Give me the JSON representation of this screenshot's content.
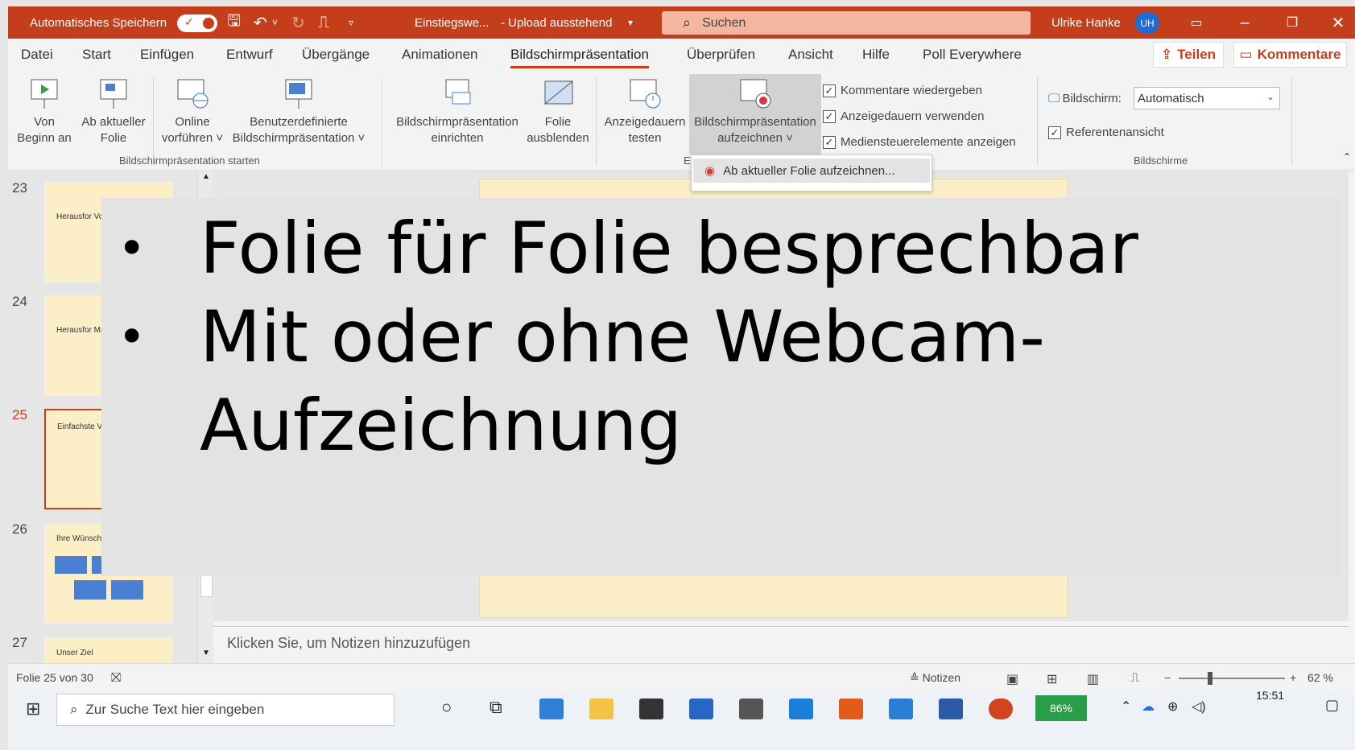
{
  "titlebar": {
    "autosave_label": "Automatisches Speichern",
    "doc_name": "Einstiegswe...",
    "doc_status": "- Upload ausstehend",
    "search_placeholder": "Suchen",
    "user_name": "Ulrike Hanke",
    "user_initials": "UH"
  },
  "tabs": [
    "Datei",
    "Start",
    "Einfügen",
    "Entwurf",
    "Übergänge",
    "Animationen",
    "Bildschirmpräsentation",
    "Überprüfen",
    "Ansicht",
    "Hilfe",
    "Poll Everywhere"
  ],
  "actions": {
    "share": "Teilen",
    "comment": "Kommentare"
  },
  "ribbon": {
    "from_start": [
      "Von",
      "Beginn an"
    ],
    "from_current": [
      "Ab aktueller",
      "Folie"
    ],
    "online": [
      "Online",
      "vorführen ˅"
    ],
    "custom": [
      "Benutzerdefinierte",
      "Bildschirmpräsentation ˅"
    ],
    "group_start": "Bildschirmpräsentation starten",
    "setup": [
      "Bildschirmpräsentation",
      "einrichten"
    ],
    "hide": [
      "Folie",
      "ausblenden"
    ],
    "rehearse": [
      "Anzeigedauern",
      "testen"
    ],
    "record": [
      "Bildschirmpräsentation",
      "aufzeichnen ˅"
    ],
    "group_setup_partial": "E",
    "checkboxes": [
      "Kommentare wiedergeben",
      "Anzeigedauern verwenden",
      "Medien­steuerelemente anzeigen"
    ],
    "monitor_label": "Bildschirm:",
    "monitor_value": "Automatisch",
    "presenter_view": "Referentenansicht",
    "group_monitors": "Bildschirme"
  },
  "dropdown": {
    "item": "Ab aktueller Folie aufzeichnen..."
  },
  "thumbnails": [
    {
      "num": "23",
      "text": "Herausfor Vorbereitu Studierenc"
    },
    {
      "num": "24",
      "text": "Herausfor Materialie"
    },
    {
      "num": "25",
      "text": "Einfachste Vid"
    },
    {
      "num": "26",
      "text": "Ihre Wünsche"
    },
    {
      "num": "27",
      "text": "Unser Ziel"
    }
  ],
  "notes_placeholder": "Klicken Sie, um Notizen hinzuzufügen",
  "status": {
    "slide_counter": "Folie 25 von 30",
    "notes_button": "Notizen",
    "zoom": "62 %"
  },
  "taskbar": {
    "search_placeholder": "Zur Suche Text hier eingeben",
    "battery": "86%",
    "time": "15:51"
  },
  "overlay": {
    "bullets": [
      "Folie für Folie besprechbar",
      "Mit oder ohne Webcam-",
      "Aufzeichnung"
    ]
  },
  "colors": {
    "accent": "#c43e1c",
    "slide_bg": "#fcefc8",
    "search_bg": "#f4b69e"
  }
}
